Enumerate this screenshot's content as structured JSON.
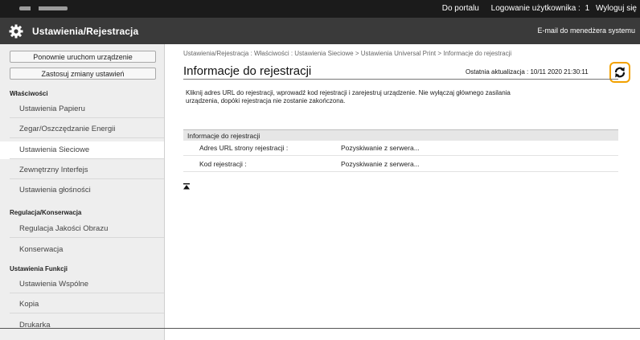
{
  "topbar": {
    "portal": "Do portalu",
    "login_user": "Logowanie użytkownika :",
    "user_num": "1",
    "logout": "Wyloguj się"
  },
  "titlebar": {
    "title": "Ustawienia/Rejestracja",
    "email": "E-mail do menedżera systemu"
  },
  "sidebar": {
    "btn_restart": "Ponownie uruchom urządzenie",
    "btn_apply": "Zastosuj zmiany ustawień",
    "sections": {
      "wlasciwosci": "Właściwości",
      "regulacja": "Regulacja/Konserwacja",
      "funkcji": "Ustawienia Funkcji"
    },
    "items": [
      "Ustawienia Papieru",
      "Zegar/Oszczędzanie Energii",
      "Ustawienia Sieciowe",
      "Zewnętrzny Interfejs",
      "Ustawienia głośności",
      "Regulacja Jakości Obrazu",
      "Konserwacja",
      "Ustawienia Wspólne",
      "Kopia",
      "Drukarka"
    ]
  },
  "main": {
    "breadcrumb": "Ustawienia/Rejestracja : Właściwości : Ustawienia Sieciowe > Ustawienia Universal Print > Informacje do rejestracji",
    "title": "Informacje do rejestracji",
    "last_update": "Ostatnia aktualizacja : 10/11 2020 21:30:11",
    "description": "Kliknij adres URL do rejestracji, wprowadź kod rejestracji i zarejestruj urządzenie. Nie wyłączaj głównego zasilania urządzenia, dopóki rejestracja nie zostanie zakończona.",
    "section_header": "Informacje do rejestracji",
    "rows": [
      {
        "label": "Adres URL strony rejestracji :",
        "value": "Pozyskiwanie z serwera..."
      },
      {
        "label": "Kod rejestracji :",
        "value": "Pozyskiwanie z serwera..."
      }
    ]
  },
  "colors": {
    "highlight": "#f2a100",
    "topbar": "#1b1b1b",
    "titlebar": "#3a3a3a"
  },
  "icons": {
    "gear": "gear-icon",
    "refresh": "refresh-icon",
    "top": "go-to-top-icon"
  }
}
